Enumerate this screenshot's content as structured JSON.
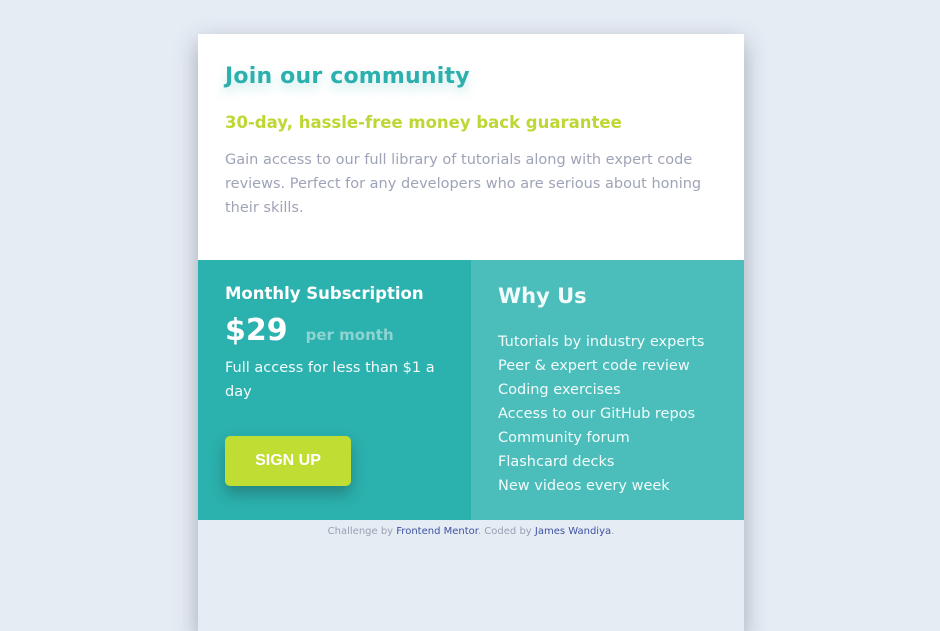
{
  "top": {
    "title": "Join our community",
    "guarantee": "30-day, hassle-free money back guarantee",
    "description": "Gain access to our full library of tutorials along with expert code reviews. Perfect for any developers who are serious about honing their skills."
  },
  "monthly": {
    "heading": "Monthly Subscription",
    "price": "$29",
    "period": "per month",
    "access": "Full access for less than $1 a day",
    "signup_label": "SIGN UP"
  },
  "why": {
    "heading": "Why Us",
    "items": [
      "Tutorials by industry experts",
      "Peer & expert code review",
      "Coding exercises",
      "Access to our GitHub repos",
      "Community forum",
      "Flashcard decks",
      "New videos every week"
    ]
  },
  "attribution": {
    "challenge_prefix": "Challenge by ",
    "challenge_link": "Frontend Mentor",
    "coded_prefix": ". Coded by ",
    "coder_link": "James Wandiya",
    "suffix": "."
  },
  "colors": {
    "accent_teal": "#2cb0ae",
    "accent_lime": "#bfd734",
    "panel_light": "#4bbebb",
    "background": "#e6ecf4"
  }
}
